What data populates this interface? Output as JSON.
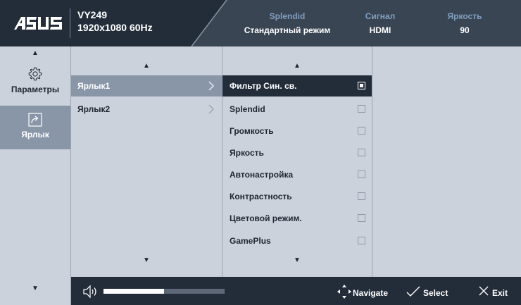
{
  "header": {
    "logo_text": "ASUS",
    "model": "VY249",
    "resolution": "1920x1080 60Hz",
    "stats": [
      {
        "label": "Splendid",
        "value": "Стандартный режим"
      },
      {
        "label": "Сигнал",
        "value": "HDMI"
      },
      {
        "label": "Яркость",
        "value": "90"
      }
    ]
  },
  "sidebar": {
    "items": [
      {
        "label": "Параметры",
        "icon": "gear-icon",
        "active": false
      },
      {
        "label": "Ярлык",
        "icon": "shortcut-icon",
        "active": true
      }
    ]
  },
  "column1": {
    "items": [
      {
        "label": "Ярлык1",
        "selected": true
      },
      {
        "label": "Ярлык2",
        "selected": false
      }
    ]
  },
  "column2": {
    "items": [
      {
        "label": "Фильтр Син. св.",
        "checked": true,
        "selected": true
      },
      {
        "label": "Splendid",
        "checked": false,
        "selected": false
      },
      {
        "label": "Громкость",
        "checked": false,
        "selected": false
      },
      {
        "label": "Яркость",
        "checked": false,
        "selected": false
      },
      {
        "label": "Автонастройка",
        "checked": false,
        "selected": false
      },
      {
        "label": "Контрастность",
        "checked": false,
        "selected": false
      },
      {
        "label": "Цветовой режим.",
        "checked": false,
        "selected": false
      },
      {
        "label": "GamePlus",
        "checked": false,
        "selected": false
      }
    ]
  },
  "footer": {
    "volume_level": 0.5,
    "navigate_label": "Navigate",
    "select_label": "Select",
    "exit_label": "Exit"
  },
  "colors": {
    "header_bg": "#232d3a",
    "panel_bg": "#ccd2dc",
    "highlight": "#8996a8",
    "accent_label": "#7f9ec0"
  }
}
